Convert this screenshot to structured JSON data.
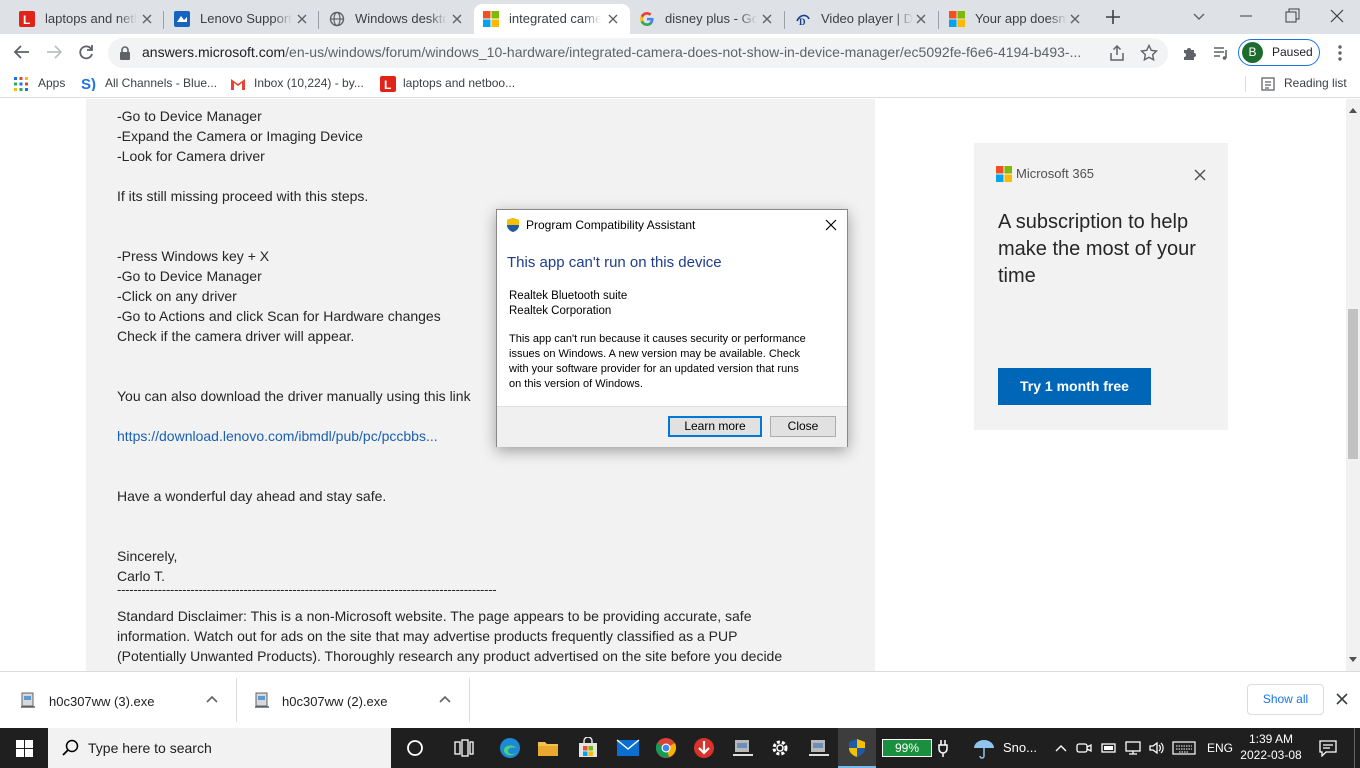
{
  "browser": {
    "tabs": [
      {
        "title": "laptops and netb",
        "icon": "lenovo-icon",
        "active": false
      },
      {
        "title": "Lenovo Support",
        "icon": "lenovo-support-icon",
        "active": false
      },
      {
        "title": "Windows deskto",
        "icon": "globe-icon",
        "active": false
      },
      {
        "title": "integrated camer",
        "icon": "microsoft-icon",
        "active": true
      },
      {
        "title": "disney plus - Goo",
        "icon": "google-icon",
        "active": false
      },
      {
        "title": "Video player | Di",
        "icon": "disney-icon",
        "active": false
      },
      {
        "title": "Your app doesn't",
        "icon": "microsoft-icon",
        "active": false
      }
    ],
    "address": {
      "domain": "answers.microsoft.com",
      "path": "/en-us/windows/forum/windows_10-hardware/integrated-camera-does-not-show-in-device-manager/ec5092fe-f6e6-4194-b493-..."
    },
    "profile": {
      "initial": "B",
      "status": "Paused"
    },
    "bookmarks": [
      {
        "label": "Apps",
        "icon": "apps-grid-icon"
      },
      {
        "label": "All Channels - Blue...",
        "icon": "s-icon"
      },
      {
        "label": "Inbox (10,224) - by...",
        "icon": "gmail-icon"
      },
      {
        "label": "laptops and netboo...",
        "icon": "lenovo-icon"
      }
    ],
    "reading_list": "Reading list"
  },
  "post": {
    "lines": [
      "-Go to Device Manager",
      "-Expand the Camera or Imaging Device",
      "-Look for Camera driver",
      "If its still missing proceed with this steps.",
      "-Press Windows key + X",
      "-Go to Device Manager",
      "-Click on any driver",
      "-Go to Actions and click Scan for Hardware changes",
      "Check if the camera driver will appear.",
      "You can also download the driver manually using this link",
      "https://download.lenovo.com/ibmdl/pub/pc/pccbbs...",
      "Have a wonderful day ahead and stay safe.",
      "Sincerely,",
      "Carlo T.",
      "---------------------------------------------------------------------------------------------",
      "Standard Disclaimer: This is a non-Microsoft website. The page appears to be providing accurate, safe",
      "information. Watch out for ads on the site that may advertise products frequently classified as a PUP",
      "(Potentially Unwanted Products). Thoroughly research any product advertised on the site before you decide"
    ]
  },
  "ad": {
    "brand": "Microsoft 365",
    "headline_lines": [
      "A subscription to help",
      "make the most of your",
      "time"
    ],
    "cta": "Try 1 month free"
  },
  "dialog": {
    "title": "Program Compatibility Assistant",
    "heading": "This app can't run on this device",
    "app_name": "Realtek Bluetooth suite",
    "publisher": "Realtek Corporation",
    "message_lines": [
      "This app can't run because it causes security or performance",
      "issues on Windows. A new version may be available. Check",
      "with your software provider for an updated version that runs",
      "on this version of Windows."
    ],
    "learn_more": "Learn more",
    "close": "Close"
  },
  "downloads": {
    "items": [
      "h0c307ww (3).exe",
      "h0c307ww (2).exe"
    ],
    "show_all": "Show all"
  },
  "taskbar": {
    "search_placeholder": "Type here to search",
    "battery": "99%",
    "weather": "Sno...",
    "language": "ENG",
    "time": "1:39 AM",
    "date": "2022-03-08"
  },
  "colors": {
    "tab_strip": "#dee1e6",
    "link": "#1a5fb4",
    "post_bg": "#f2f2f2",
    "ms_blue": "#0067b8",
    "dialog_heading": "#1e3c8c",
    "taskbar": "#1f1f1f",
    "battery": "#1a8f3e"
  }
}
